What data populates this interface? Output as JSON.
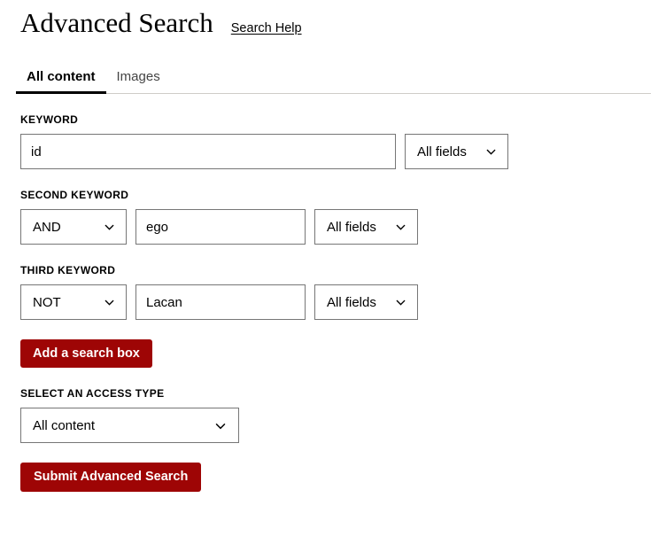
{
  "header": {
    "title": "Advanced Search",
    "help_link": "Search Help"
  },
  "tabs": [
    {
      "label": "All content",
      "active": true
    },
    {
      "label": "Images",
      "active": false
    }
  ],
  "form": {
    "keyword": {
      "label": "KEYWORD",
      "value": "id",
      "placeholder": "",
      "field_select": "All fields"
    },
    "second_keyword": {
      "label": "SECOND KEYWORD",
      "operator": "AND",
      "value": "ego",
      "placeholder": "",
      "field_select": "All fields"
    },
    "third_keyword": {
      "label": "THIRD KEYWORD",
      "operator": "NOT",
      "value": "Lacan",
      "placeholder": "",
      "field_select": "All fields"
    },
    "add_search_box_label": "Add a search box",
    "access_type": {
      "label": "SELECT AN ACCESS TYPE",
      "value": "All content"
    },
    "submit_label": "Submit Advanced Search"
  },
  "icons": {
    "chevron": "chevron-down-icon"
  },
  "colors": {
    "brand_red": "#9E0505",
    "border_gray": "#767676",
    "divider_gray": "#cfcdc8",
    "tab_inactive": "#444444"
  }
}
